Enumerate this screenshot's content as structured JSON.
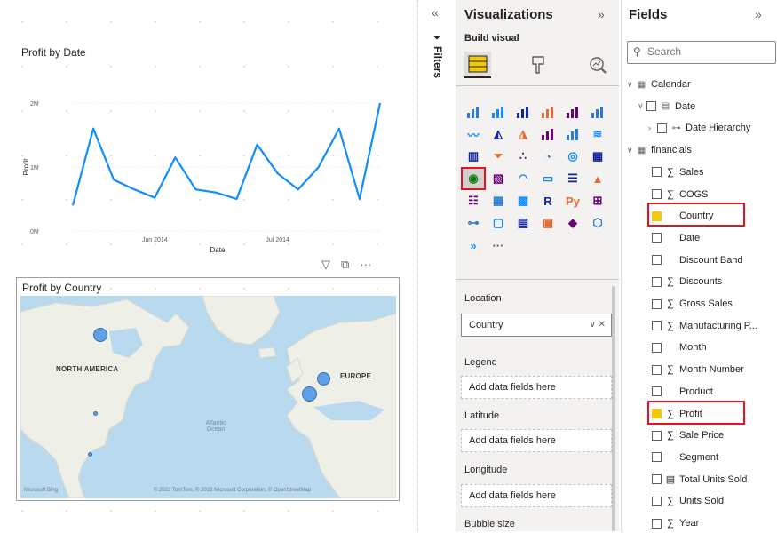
{
  "canvas": {
    "line_chart": {
      "title": "Profit by Date",
      "chart_data": {
        "type": "line",
        "title": "Profit by Date",
        "xlabel": "Date",
        "ylabel": "Profit",
        "y_ticks": [
          "0M",
          "1M",
          "2M"
        ],
        "x_ticks": [
          "Jan 2014",
          "Jul 2014"
        ],
        "ylim": [
          0,
          2000000
        ],
        "x": [
          "2013-09",
          "2013-10",
          "2013-11",
          "2013-12",
          "2014-01",
          "2014-02",
          "2014-03",
          "2014-04",
          "2014-05",
          "2014-06",
          "2014-07",
          "2014-08",
          "2014-09",
          "2014-10",
          "2014-11",
          "2014-12"
        ],
        "series": [
          {
            "values": [
              400000,
              1600000,
              800000,
              650000,
              520000,
              1150000,
              650000,
              600000,
              500000,
              1350000,
              900000,
              650000,
              1000000,
              1600000,
              500000,
              2000000
            ]
          }
        ],
        "grid": "horizontal",
        "color": "#118dff"
      }
    },
    "map": {
      "title": "Profit by Country",
      "labels": {
        "north_america": "NORTH AMERICA",
        "europe": "EUROPE",
        "ocean": "Atlantic\nOcean",
        "ms_bing": "Microsoft Bing",
        "credit": "© 2022 TomTom, © 2022 Microsoft Corporation, © OpenStreetMap"
      },
      "bubbles": [
        {
          "country": "Canada",
          "size": 14
        },
        {
          "country": "Germany",
          "size": 14
        },
        {
          "country": "France",
          "size": 16
        },
        {
          "country": "United States of America",
          "size": 3
        },
        {
          "country": "Mexico",
          "size": 3
        }
      ],
      "header_icons": [
        "filter-icon",
        "focus-mode-icon",
        "more-options-icon"
      ]
    }
  },
  "filters": {
    "label": "Filters",
    "collapse_glyph": "«"
  },
  "visualizations": {
    "title": "Visualizations",
    "expand_glyph": "»",
    "build_visual_label": "Build visual",
    "build_icons": [
      "table-visual-icon",
      "format-paint-icon",
      "analytics-icon"
    ],
    "gallery": [
      "stacked-bar-chart",
      "stacked-column-chart",
      "clustered-bar-chart",
      "clustered-column-chart",
      "100-stacked-bar-chart",
      "100-stacked-column-chart",
      "line-chart",
      "area-chart",
      "stacked-area-chart",
      "line-clustered-column-chart",
      "line-stacked-column-chart",
      "ribbon-chart",
      "waterfall-chart",
      "funnel-chart",
      "scatter-chart",
      "pie-chart",
      "donut-chart",
      "treemap",
      "map",
      "filled-map",
      "gauge",
      "card",
      "multi-row-card",
      "kpi",
      "slicer",
      "table",
      "matrix",
      "r-visual",
      "python-visual",
      "key-influencers",
      "decomposition-tree",
      "qa-visual",
      "smart-narrative",
      "paginated-report",
      "power-apps",
      "power-automate",
      "get-more-visuals",
      "more-ellipsis"
    ],
    "selected_visual": "map",
    "gallery_glyphs": {
      "r-visual": "R",
      "python-visual": "Py",
      "more-ellipsis": "···"
    },
    "wells": [
      {
        "label": "Location",
        "value": "Country",
        "filled": true
      },
      {
        "label": "Legend",
        "value": "Add data fields here",
        "filled": false
      },
      {
        "label": "Latitude",
        "value": "Add data fields here",
        "filled": false
      },
      {
        "label": "Longitude",
        "value": "Add data fields here",
        "filled": false
      },
      {
        "label": "Bubble size",
        "value": "",
        "filled": false
      }
    ]
  },
  "fields": {
    "title": "Fields",
    "expand_glyph": "»",
    "search_placeholder": "Search",
    "tables": [
      {
        "name": "Calendar",
        "expanded": true,
        "fields": [
          {
            "name": "Date",
            "type": "date",
            "expanded": true,
            "children": [
              {
                "name": "Date Hierarchy",
                "type": "hierarchy"
              }
            ]
          }
        ]
      },
      {
        "name": "financials",
        "expanded": true,
        "fields": [
          {
            "name": "Sales",
            "type": "sum",
            "checked": false
          },
          {
            "name": "COGS",
            "type": "sum",
            "checked": false
          },
          {
            "name": "Country",
            "type": "text",
            "checked": true
          },
          {
            "name": "Date",
            "type": "text",
            "checked": false
          },
          {
            "name": "Discount Band",
            "type": "text",
            "checked": false
          },
          {
            "name": "Discounts",
            "type": "sum",
            "checked": false
          },
          {
            "name": "Gross Sales",
            "type": "sum",
            "checked": false
          },
          {
            "name": "Manufacturing P...",
            "type": "sum",
            "checked": false
          },
          {
            "name": "Month",
            "type": "text",
            "checked": false
          },
          {
            "name": "Month Number",
            "type": "sum",
            "checked": false
          },
          {
            "name": "Product",
            "type": "text",
            "checked": false
          },
          {
            "name": "Profit",
            "type": "sum",
            "checked": true
          },
          {
            "name": "Sale Price",
            "type": "sum",
            "checked": false
          },
          {
            "name": "Segment",
            "type": "text",
            "checked": false
          },
          {
            "name": "Total Units Sold",
            "type": "calc",
            "checked": false
          },
          {
            "name": "Units Sold",
            "type": "sum",
            "checked": false
          },
          {
            "name": "Year",
            "type": "sum",
            "checked": false
          }
        ]
      }
    ]
  },
  "colors": {
    "accent": "#f2c811",
    "highlight": "#e81123",
    "line": "#118dff",
    "bubble": "#5fa0e6"
  }
}
